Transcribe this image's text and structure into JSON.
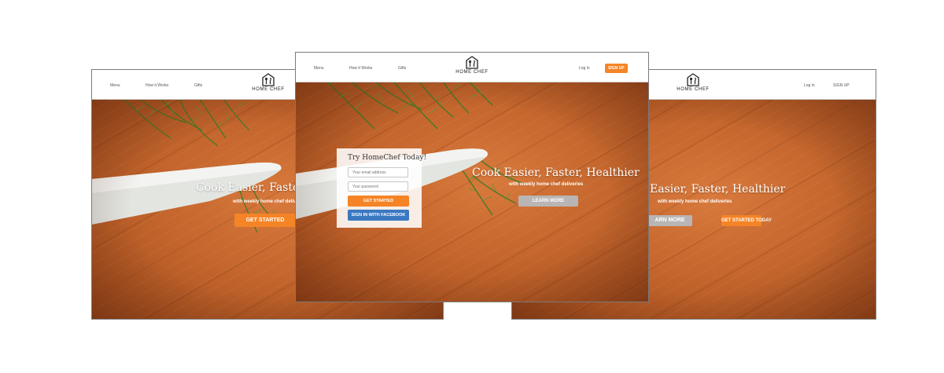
{
  "brand": {
    "name": "HOME CHEF",
    "accent_color": "#f58426",
    "facebook_color": "#3b78c2"
  },
  "left_screen": {
    "nav": {
      "menu": "Menu",
      "how_it_works": "How it Works",
      "gifts": "Gifts"
    },
    "logo_text": "HOME CHEF",
    "headline": "Cook Easier, Faster",
    "subheadline": "with weekly home chef deliveries",
    "cta": "GET STARTED"
  },
  "center_screen": {
    "nav": {
      "menu": "Menu",
      "how_it_works": "How it Works",
      "gifts": "Gifts",
      "login": "Log in",
      "signup": "SIGN UP"
    },
    "logo_text": "HOME CHEF",
    "headline": "Cook Easier, Faster, Healthier",
    "subheadline": "with weekly home chef deliveries",
    "learn_more": "LEARN MORE",
    "signup_card": {
      "title": "Try HomeChef Today!",
      "email_placeholder": "Your email address",
      "password_placeholder": "Your password",
      "get_started": "GET STARTED",
      "facebook": "SIGN IN WITH FACEBOOK"
    }
  },
  "right_screen": {
    "nav": {
      "login": "Log in",
      "signup": "SIGN UP"
    },
    "logo_text": "HOME CHEF",
    "headline": "Easier, Faster, Healthier",
    "subheadline": "with weekly home chef deliveries",
    "learn_more": "ARN MORE",
    "cta": "GET STARTED TODAY"
  },
  "icons": [
    "chef-hat-fork-knife-icon"
  ]
}
